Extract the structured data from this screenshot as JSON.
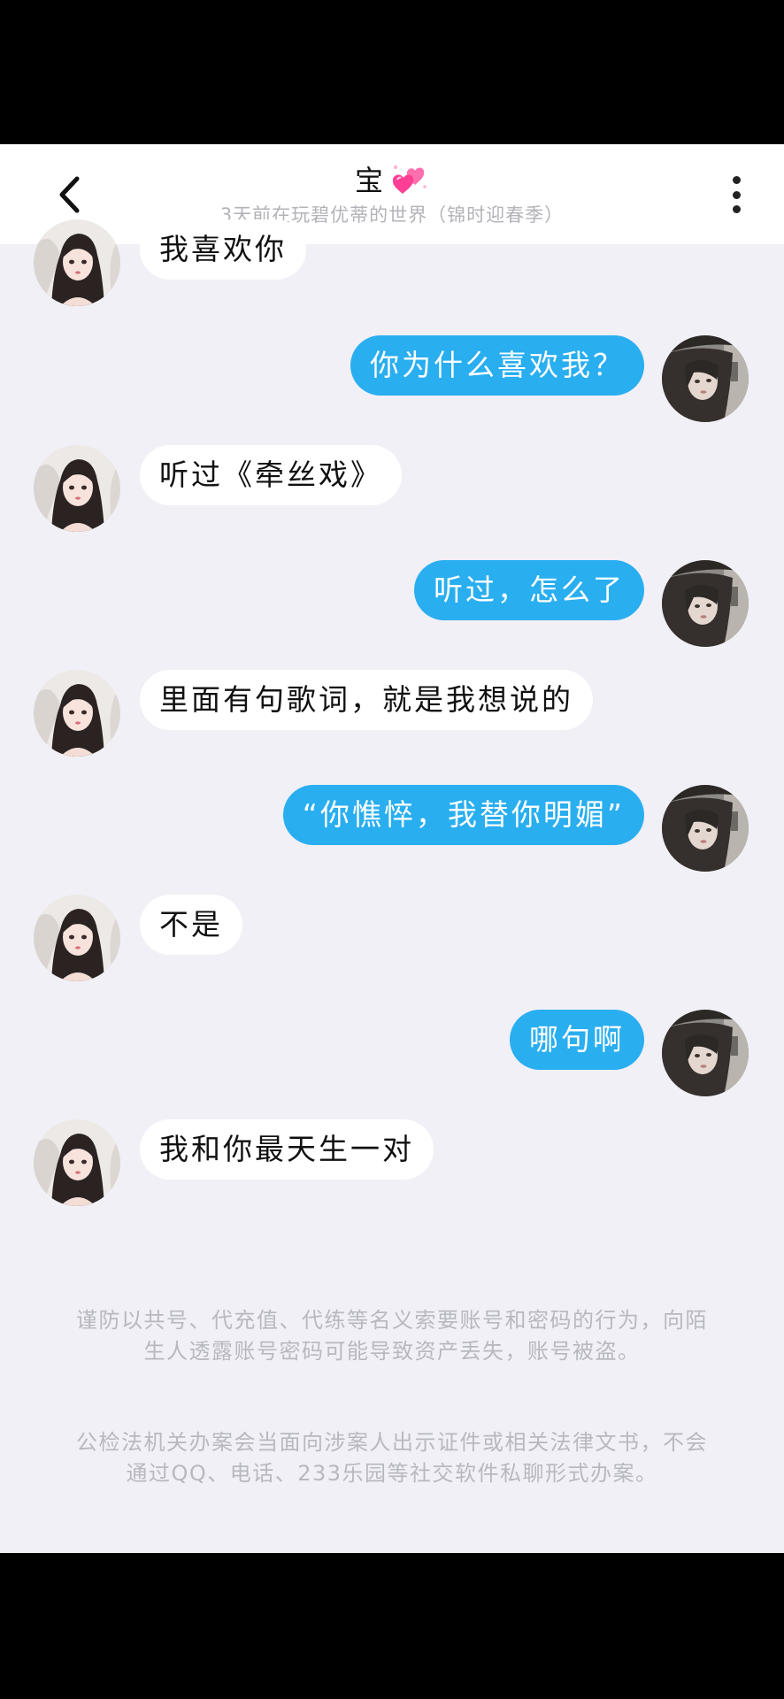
{
  "header": {
    "back_icon": "chevron-left-icon",
    "title": "宝",
    "title_icon": "sparkling-hearts-icon",
    "subtitle": "3天前在玩碧优蒂的世界（锦时迎春季）",
    "more_icon": "more-vertical-icon"
  },
  "messages": [
    {
      "side": "in",
      "text": "我喜欢你"
    },
    {
      "side": "out",
      "text": "你为什么喜欢我？"
    },
    {
      "side": "in",
      "text": "听过《牵丝戏》"
    },
    {
      "side": "out",
      "text": "听过，怎么了"
    },
    {
      "side": "in",
      "text": "里面有句歌词，就是我想说的"
    },
    {
      "side": "out",
      "text": "“你憔悴，我替你明媚”"
    },
    {
      "side": "in",
      "text": "不是"
    },
    {
      "side": "out",
      "text": "哪句啊"
    },
    {
      "side": "in",
      "text": "我和你最天生一对"
    }
  ],
  "notices": [
    "谨防以共号、代充值、代练等名义索要账号和密码的行为，向陌生人透露账号密码可能导致资产丢失，账号被盗。",
    "公检法机关办案会当面向涉案人出示证件或相关法律文书，不会通过QQ、电话、233乐园等社交软件私聊形式办案。"
  ],
  "colors": {
    "outgoing_bubble": "#29aef0",
    "incoming_bubble": "#ffffff",
    "chat_background": "#f1f0f7",
    "notice_text": "#b8b8bf"
  }
}
